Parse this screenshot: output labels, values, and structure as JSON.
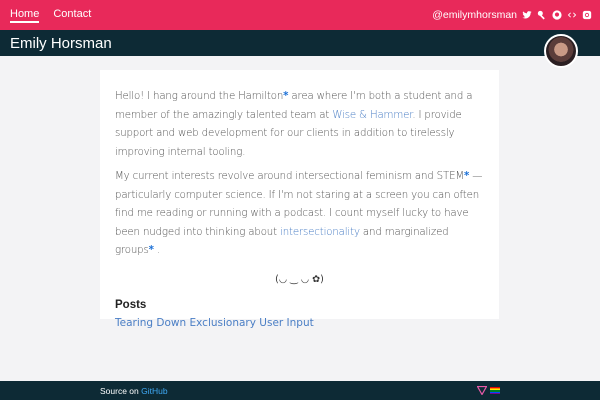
{
  "topbar": {
    "nav": [
      {
        "label": "Home",
        "active": true
      },
      {
        "label": "Contact",
        "active": false
      }
    ],
    "handle": "@emilymhorsman",
    "social_icons": [
      "twitter-icon",
      "key-icon",
      "github-icon",
      "code-icon",
      "instagram-icon"
    ],
    "color": "#e8295a"
  },
  "header": {
    "name": "Emily Horsman",
    "color": "#0d2a35"
  },
  "about": {
    "p1_a": "Hello! I hang around the Hamilton",
    "p1_b": " area where I'm both a student and a member of the amazingly talented team at ",
    "p1_link": "Wise & Hammer",
    "p1_c": ". I provide support and web development for our clients in addition to tirelessly improving internal tooling.",
    "p2_a": "My current interests revolve around intersectional feminism and STEM",
    "p2_b": " — particularly computer science. If I'm not staring at a screen you can often find me reading or running with a podcast. I count myself lucky to have been nudged into thinking about ",
    "p2_link": "intersectionality",
    "p2_c": " and marginalized groups",
    "p2_d": " .",
    "star": "*",
    "kaomoji": "(◡ ‿ ◡ ✿)"
  },
  "posts": {
    "heading": "Posts",
    "items": [
      "Tearing Down Exclusionary User Input"
    ]
  },
  "footer": {
    "source_label": "Source on ",
    "source_link": "GitHub",
    "flags": [
      "trans-flag-icon",
      "pride-flag-icon"
    ],
    "link_color": "#3fa9f5"
  }
}
